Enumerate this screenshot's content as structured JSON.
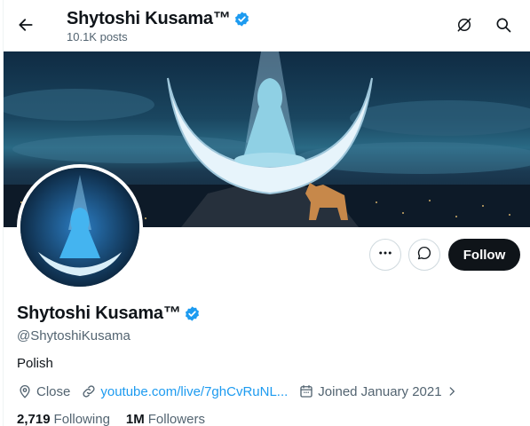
{
  "header": {
    "title": "Shytoshi Kusama™",
    "posts_count": "10.1K posts"
  },
  "profile": {
    "display_name": "Shytoshi Kusama™",
    "handle": "@ShytoshiKusama",
    "bio": "Polish",
    "location": "Close",
    "link": "youtube.com/live/7ghCvRuNL...",
    "joined": "Joined January 2021",
    "following_count": "2,719",
    "following_label": "Following",
    "followers_count": "1M",
    "followers_label": "Followers"
  },
  "actions": {
    "follow_label": "Follow"
  },
  "colors": {
    "accent": "#1d9bf0",
    "primary_button": "#0f1419",
    "secondary_text": "#536471",
    "verified": "#1d9bf0"
  },
  "icons": {
    "back": "arrow-left-icon",
    "grok": "grok-icon",
    "search": "search-icon",
    "more": "more-icon",
    "message": "message-icon",
    "location": "location-icon",
    "link": "link-icon",
    "calendar": "calendar-icon",
    "verified": "verified-badge-icon"
  }
}
